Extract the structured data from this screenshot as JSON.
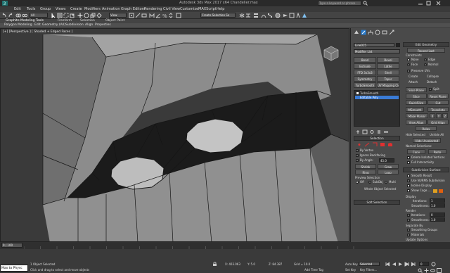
{
  "title": "Autodesk 3ds Max 2017 x64    Chandelier.max",
  "search_placeholder": "Type a keyword or phrase",
  "menu": [
    "Edit",
    "Tools",
    "Group",
    "Views",
    "Create",
    "Modifiers",
    "Animation",
    "Graph Editors",
    "Rendering",
    "Civil View",
    "Customize",
    "MAXScript",
    "Help"
  ],
  "toolbar": {
    "selection_filter": "All",
    "view_dropdown": "View",
    "named_selection": "Create Selection Se"
  },
  "ribbon": {
    "tabs": [
      "Graphite Modeling Tools",
      "Freeform",
      "Selection",
      "Object Paint"
    ],
    "subtabs": [
      "Polygon Modeling",
      "Edit",
      "Geometry (All)",
      "Subdivision",
      "Align",
      "Properties"
    ]
  },
  "viewport": {
    "label": "[+] [Perspective ] [ Shaded + Edged Faces ]"
  },
  "cmd": {
    "object_name": "Line015",
    "modifier_list": "Modifier List",
    "mod_buttons": [
      "Bend",
      "Bevel",
      "Extrude",
      "Lathe",
      "FFD 3x3x3",
      "Shell",
      "Symmetry",
      "Taper",
      "TurboSmooth",
      "UV Mapping Cle"
    ],
    "stack": [
      "TurboSmooth",
      "Editable Poly"
    ],
    "selection_header": "Selection",
    "by_vertex": "By Vertex",
    "ignore_backfacing": "Ignore Backfacing",
    "by_angle": "By Angle:",
    "by_angle_val": "45.0",
    "shrink": "Shrink",
    "grow": "Grow",
    "ring": "Ring",
    "loop": "Loop",
    "preview_selection": "Preview Selection",
    "preview_opts": [
      "Off",
      "SubObj",
      "Multi"
    ],
    "whole_selected": "Whole Object Selected",
    "soft_selection": "Soft Selection",
    "edit_geometry": "Edit Geometry",
    "repeat_last": "Repeat Last",
    "constraints": "Constraints",
    "constraint_opts": [
      "None",
      "Edge",
      "Face",
      "Normal"
    ],
    "preserve_uvs": "Preserve UVs",
    "create": "Create",
    "collapse": "Collapse",
    "attach": "Attach",
    "detach": "Detach",
    "slice_plane": "Slice Plane",
    "split": "Split",
    "slice": "Slice",
    "reset_plane": "Reset Plane",
    "quickslice": "QuickSlice",
    "cut": "Cut",
    "msmooth": "MSmooth",
    "tessellate": "Tessellate",
    "make_planar": "Make Planar",
    "xyz": [
      "X",
      "Y",
      "Z"
    ],
    "view_align": "View Align",
    "grid_align": "Grid Align",
    "relax": "Relax",
    "hide_selected": "Hide Selected",
    "unhide_all": "Unhide All",
    "hide_unselected": "Hide Unselected",
    "named_selections": "Named Selections:",
    "copy": "Copy",
    "paste": "Paste",
    "delete_isolated": "Delete Isolated Vertices",
    "full_interactivity": "Full Interactivity",
    "subdiv_surface": "Subdivision Surface",
    "smooth_result": "Smooth Result",
    "use_nurms": "Use NURMS Subdivision",
    "isoline": "Isoline Display",
    "show_cage": "Show Cage......",
    "display": "Display",
    "iterations": "Iterations:",
    "iterations_val": "1",
    "smoothness": "Smoothness:",
    "smoothness_val": "1.0",
    "render": "Render",
    "r_iterations_val": "0",
    "r_smoothness_val": "1.0",
    "separate_by": "Separate By",
    "smoothing_groups": "Smoothing Groups",
    "materials": "Materials",
    "update_options": "Update Options",
    "update_opts": [
      "Always",
      "When Rendering",
      "Manually"
    ],
    "cage_colors": [
      "#e0a020",
      "#e06010"
    ]
  },
  "timeline": {
    "frame": "0 / 100",
    "ticks": [
      "0",
      "5",
      "10",
      "15",
      "20",
      "25",
      "30",
      "35",
      "40",
      "45",
      "50",
      "55",
      "60",
      "65",
      "70",
      "75",
      "80",
      "85",
      "90",
      "95",
      "100"
    ]
  },
  "status": {
    "maxscript": "Max to Physc",
    "selected": "1 Object Selected",
    "prompt": "Click and drag to select and move objects",
    "x": "X: 403.063",
    "y": "Y: 5.0",
    "z": "Z: 84.387",
    "grid": "Grid = 10.0",
    "add_time_tag": "Add Time Tag",
    "auto_key": "Auto Key",
    "selected_dd": "Selected",
    "set_key": "Set Key",
    "key_filters": "Key Filters...",
    "frame": "0"
  }
}
